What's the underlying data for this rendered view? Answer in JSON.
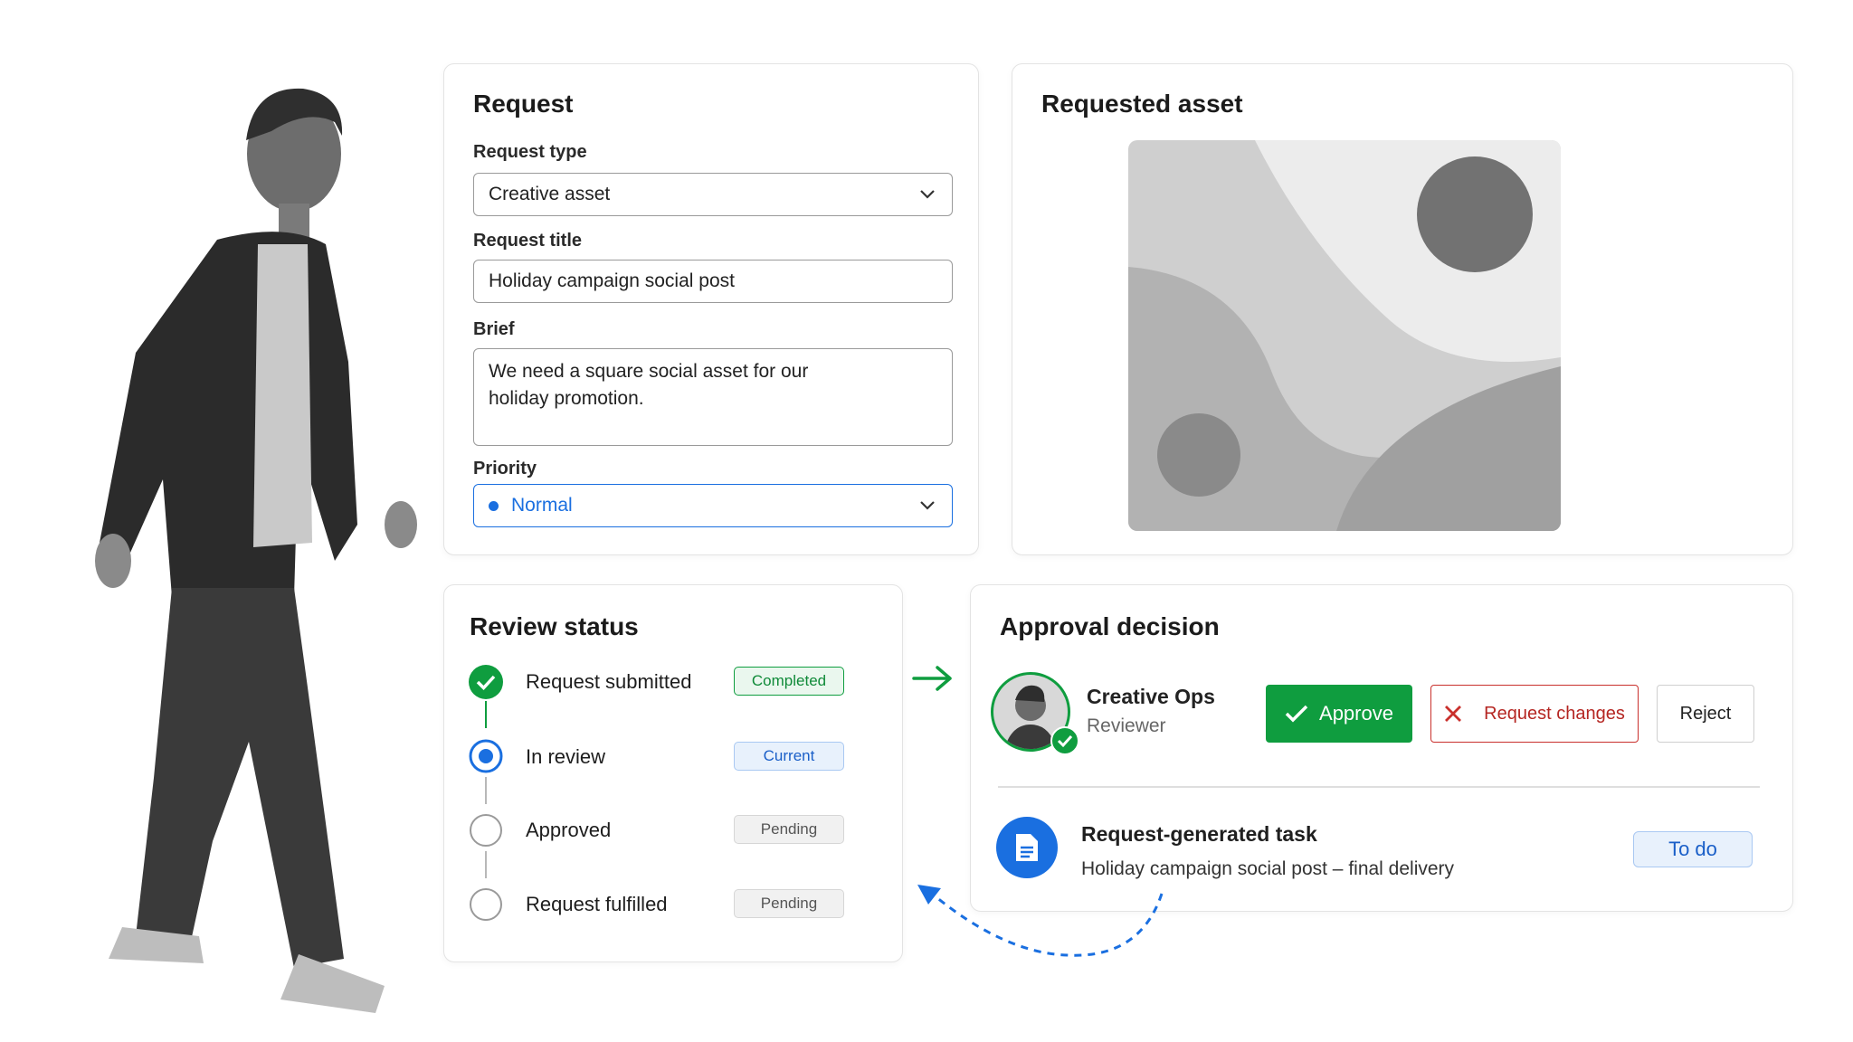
{
  "request": {
    "title": "Request",
    "type_label": "Request type",
    "type_value": "Creative asset",
    "title_label": "Request title",
    "title_value": "Holiday campaign social post",
    "brief_label": "Brief",
    "brief_value": "We need a square social asset for our holiday promotion.",
    "priority_label": "Priority",
    "priority_value": "Normal"
  },
  "asset": {
    "title": "Requested asset"
  },
  "review": {
    "title": "Review status",
    "steps": [
      {
        "label": "Request submitted",
        "badge": "Completed"
      },
      {
        "label": "In review",
        "badge": "Current"
      },
      {
        "label": "Approved",
        "badge": "Pending"
      },
      {
        "label": "Request fulfilled",
        "badge": "Pending"
      }
    ]
  },
  "approval": {
    "title": "Approval decision",
    "reviewer_name": "Creative Ops",
    "reviewer_role": "Reviewer",
    "approve_label": "Approve",
    "changes_label": "Request changes",
    "reject_label": "Reject",
    "task_title": "Request-generated task",
    "task_subtitle": "Holiday campaign social post – final delivery",
    "task_status": "To do"
  },
  "colors": {
    "green": "#0f9d3f",
    "blue": "#1a6fe0",
    "red": "#c9302c"
  },
  "icons": [
    "chevron-down-icon",
    "check-icon",
    "close-icon",
    "document-icon",
    "arrow-right-icon"
  ]
}
